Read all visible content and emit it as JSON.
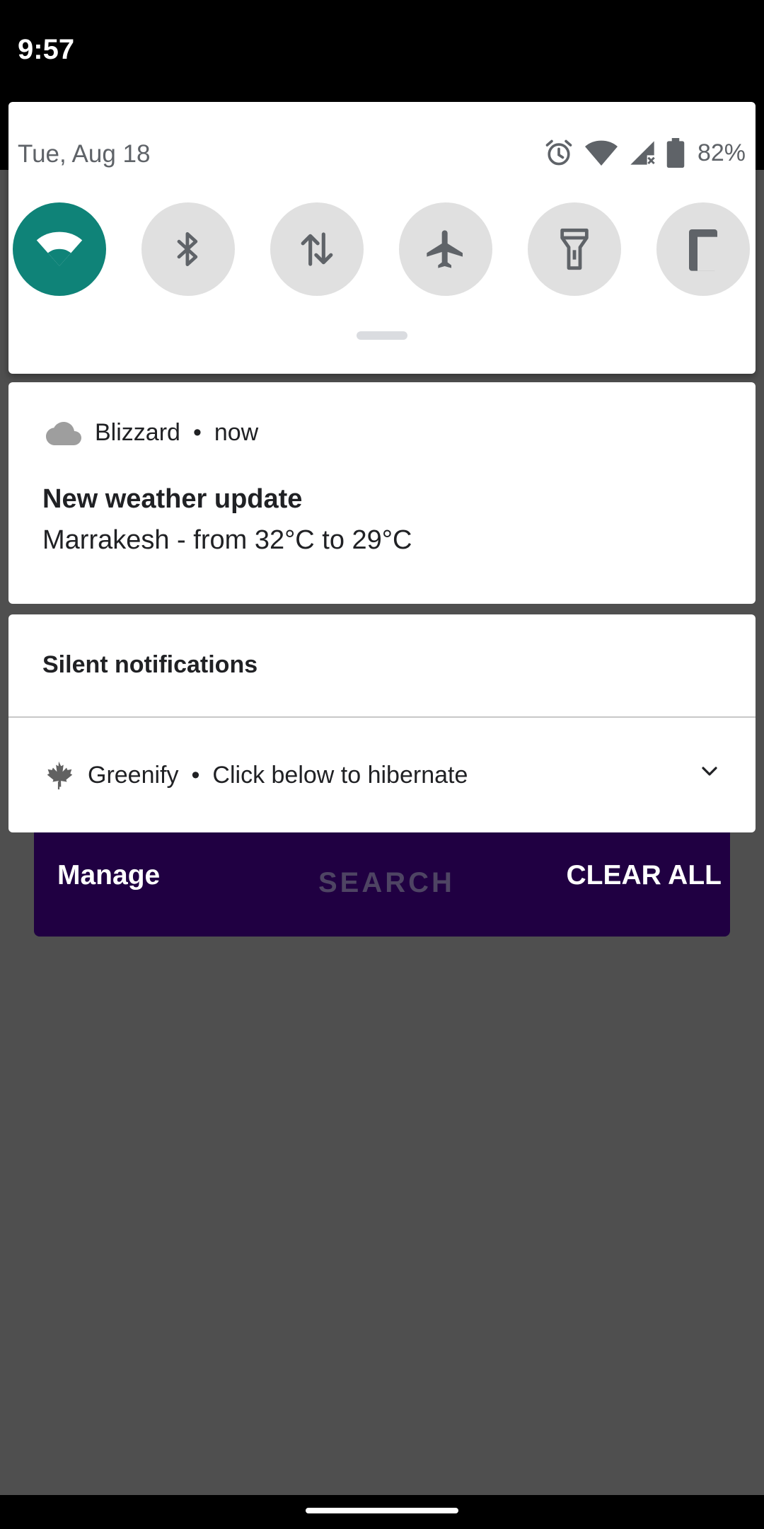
{
  "status_bar": {
    "time": "9:57"
  },
  "quick_settings": {
    "date": "Tue, Aug 18",
    "battery": "82%",
    "icons": [
      "alarm-icon",
      "wifi-signal-icon",
      "cell-signal-no-service-icon",
      "battery-icon"
    ],
    "tiles": [
      {
        "name": "wifi",
        "icon": "wifi-icon",
        "active": true
      },
      {
        "name": "bluetooth",
        "icon": "bluetooth-icon",
        "active": false
      },
      {
        "name": "mobile-data",
        "icon": "data-arrows-icon",
        "active": false
      },
      {
        "name": "airplane-mode",
        "icon": "airplane-icon",
        "active": false
      },
      {
        "name": "flashlight",
        "icon": "flashlight-icon",
        "active": false
      },
      {
        "name": "battery-saver",
        "icon": "battery-saver-icon",
        "active": false
      }
    ],
    "colors": {
      "active_tile": "#0f8378",
      "inactive_tile": "#e0e0e0"
    }
  },
  "notifications": {
    "weather": {
      "app": "Blizzard",
      "time": "now",
      "title": "New weather update",
      "body": "Marrakesh - from 32°C to 29°C"
    },
    "silent_header": "Silent notifications",
    "greenify": {
      "app": "Greenify",
      "text": "Click below to hibernate"
    }
  },
  "app_behind": {
    "manage": "Manage",
    "search": "SEARCH",
    "clear_all": "CLEAR ALL",
    "color": "#200042"
  }
}
